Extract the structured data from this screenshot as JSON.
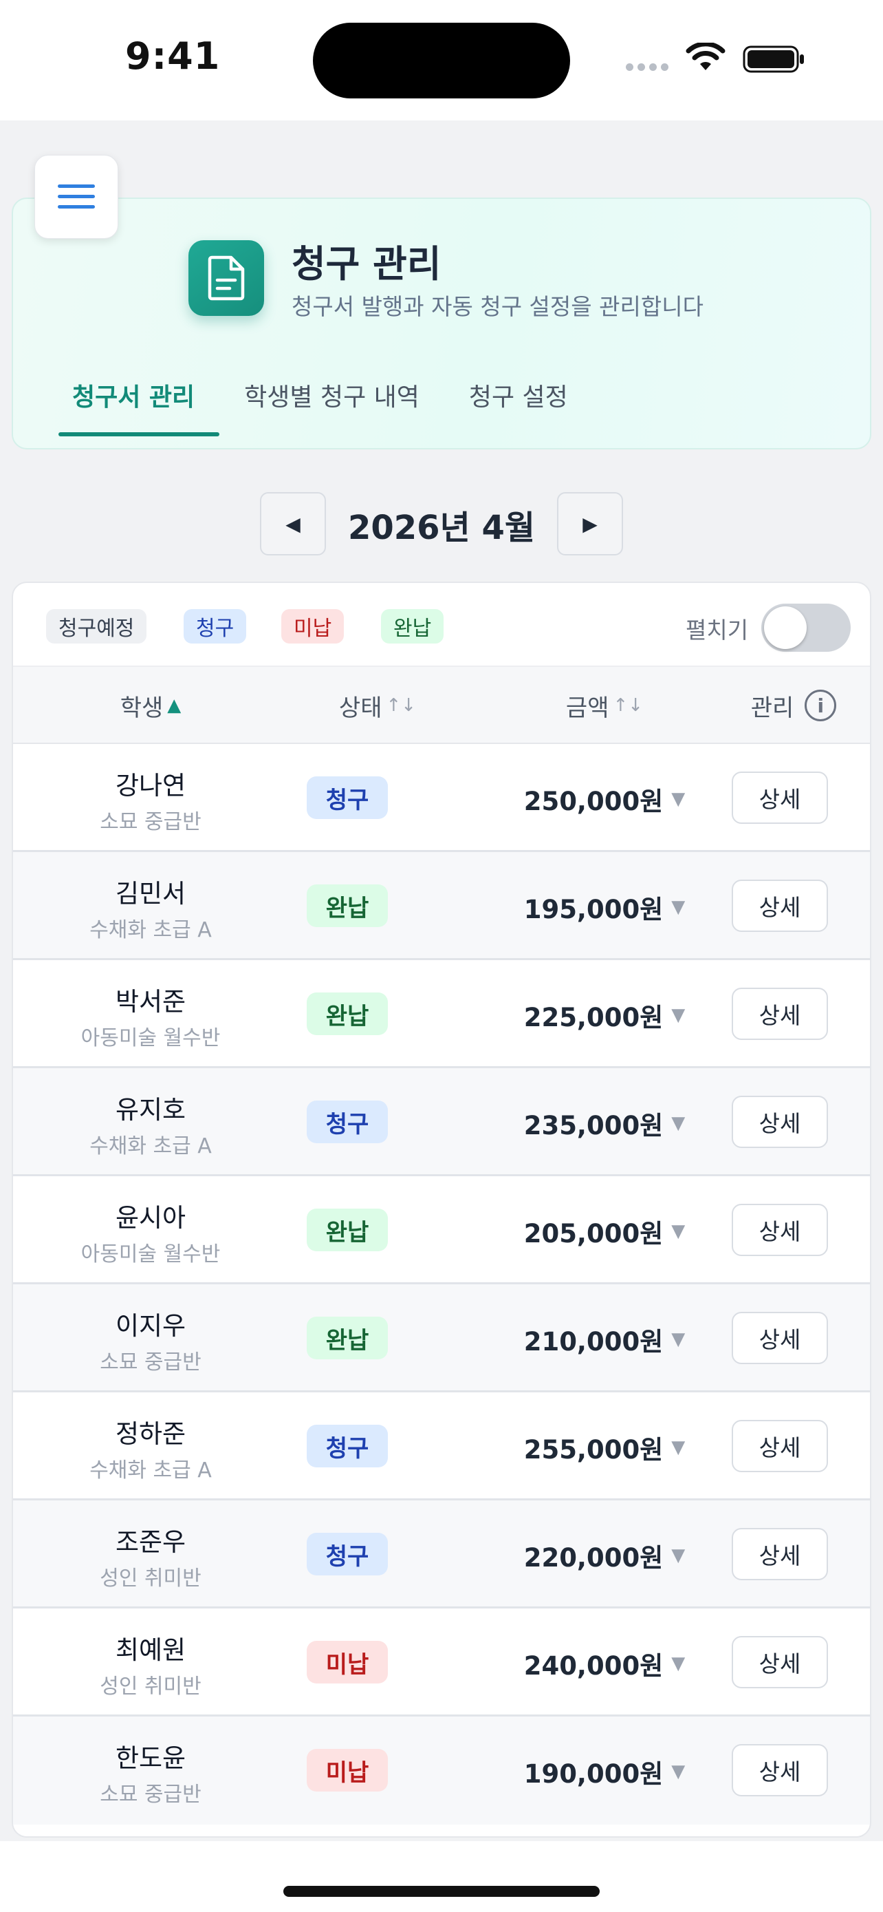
{
  "status_bar": {
    "time": "9:41"
  },
  "header": {
    "title": "청구 관리",
    "subtitle": "청구서 발행과 자동 청구 설정을 관리합니다",
    "tabs": [
      {
        "label": "청구서 관리",
        "active": true
      },
      {
        "label": "학생별 청구 내역",
        "active": false
      },
      {
        "label": "청구 설정",
        "active": false
      }
    ]
  },
  "month_nav": {
    "label": "2026년 4월",
    "prev": "◀",
    "next": "▶"
  },
  "filters": {
    "chips": [
      "청구예정",
      "청구",
      "미납",
      "완납"
    ],
    "expand_label": "펼치기",
    "expand_on": false
  },
  "table": {
    "headers": {
      "student": "학생",
      "status": "상태",
      "amount": "금액",
      "manage": "관리"
    },
    "detail_label": "상세",
    "rows": [
      {
        "name": "강나연",
        "class": "소묘 중급반",
        "status": "청구",
        "amount": "250,000원"
      },
      {
        "name": "김민서",
        "class": "수채화 초급 A",
        "status": "완납",
        "amount": "195,000원"
      },
      {
        "name": "박서준",
        "class": "아동미술 월수반",
        "status": "완납",
        "amount": "225,000원"
      },
      {
        "name": "유지호",
        "class": "수채화 초급 A",
        "status": "청구",
        "amount": "235,000원"
      },
      {
        "name": "윤시아",
        "class": "아동미술 월수반",
        "status": "완납",
        "amount": "205,000원"
      },
      {
        "name": "이지우",
        "class": "소묘 중급반",
        "status": "완납",
        "amount": "210,000원"
      },
      {
        "name": "정하준",
        "class": "수채화 초급 A",
        "status": "청구",
        "amount": "255,000원"
      },
      {
        "name": "조준우",
        "class": "성인 취미반",
        "status": "청구",
        "amount": "220,000원"
      },
      {
        "name": "최예원",
        "class": "성인 취미반",
        "status": "미납",
        "amount": "240,000원"
      },
      {
        "name": "한도윤",
        "class": "소묘 중급반",
        "status": "미납",
        "amount": "190,000원"
      }
    ]
  },
  "colors": {
    "accent": "#128a78",
    "billed": "#1e40af",
    "paid": "#166534",
    "unpaid": "#b91c1c"
  }
}
